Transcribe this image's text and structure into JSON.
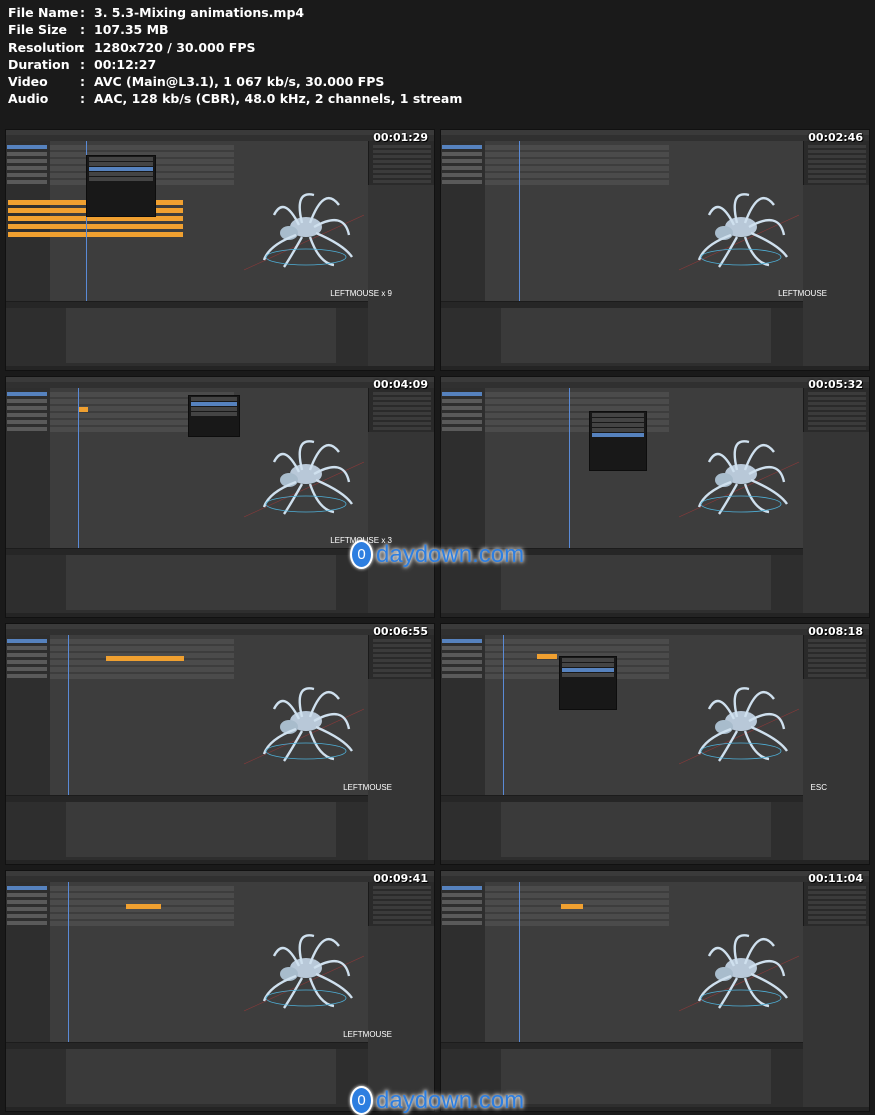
{
  "file_info": {
    "rows": [
      {
        "key": "File Name",
        "sep": ":",
        "value": "3. 5.3-Mixing animations.mp4"
      },
      {
        "key": "File Size",
        "sep": ":",
        "value": "107.35 MB"
      },
      {
        "key": "Resolution",
        "sep": ":",
        "value": "1280x720 / 30.000 FPS"
      },
      {
        "key": "Duration",
        "sep": ":",
        "value": "00:12:27"
      },
      {
        "key": "Video",
        "sep": ":",
        "value": "AVC (Main@L3.1), 1 067 kb/s, 30.000 FPS"
      },
      {
        "key": "Audio",
        "sep": ":",
        "value": "AAC, 128 kb/s (CBR), 48.0 kHz, 2 channels, 1 stream"
      }
    ]
  },
  "thumbnails": [
    {
      "timestamp": "00:01:29",
      "caption": "LEFTMOUSE x 9"
    },
    {
      "timestamp": "00:02:46",
      "caption": "LEFTMOUSE"
    },
    {
      "timestamp": "00:04:09",
      "caption": "LEFTMOUSE x 3"
    },
    {
      "timestamp": "00:05:32",
      "caption": ""
    },
    {
      "timestamp": "00:06:55",
      "caption": "LEFTMOUSE"
    },
    {
      "timestamp": "00:08:18",
      "caption": "ESC"
    },
    {
      "timestamp": "00:09:41",
      "caption": "LEFTMOUSE"
    },
    {
      "timestamp": "00:11:04",
      "caption": ""
    }
  ],
  "watermark": {
    "logo": "0",
    "text": "daydown.com"
  },
  "colors": {
    "accent": "#5682be",
    "strip": "#f0a030",
    "watermark": "#2d7ee0"
  }
}
